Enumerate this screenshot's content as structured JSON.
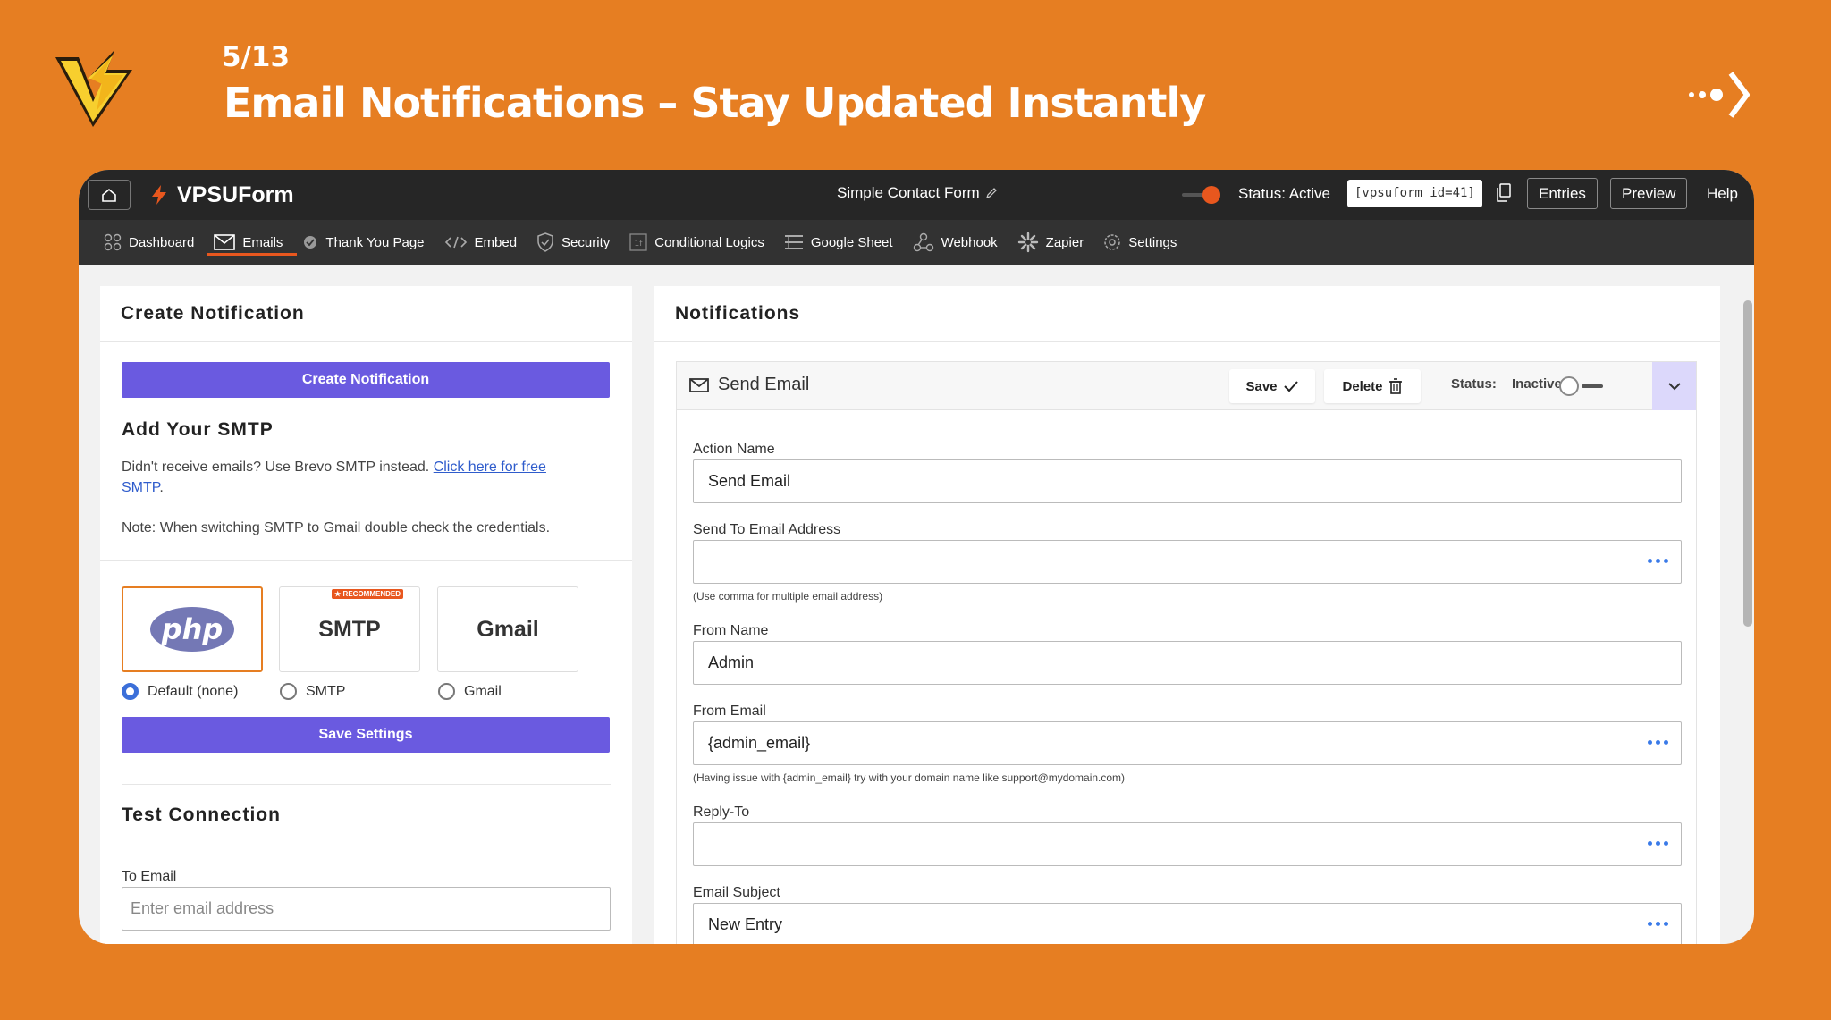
{
  "hero": {
    "counter": "5/13",
    "title": "Email Notifications – Stay Updated Instantly"
  },
  "colors": {
    "background": "#e67e22",
    "accent_purple": "#6a5ae0",
    "accent_orange": "#e8571e",
    "topbar": "#262626"
  },
  "topbar": {
    "brand": "VPSUForm",
    "form_name": "Simple Contact Form",
    "status": "Status: Active",
    "shortcode": "[vpsuform id=41]",
    "entries": "Entries",
    "preview": "Preview",
    "help": "Help"
  },
  "nav": [
    {
      "label": "Dashboard",
      "icon": "dashboard-icon"
    },
    {
      "label": "Emails",
      "icon": "envelope-icon",
      "active": true
    },
    {
      "label": "Thank You Page",
      "icon": "check-circle-icon"
    },
    {
      "label": "Embed",
      "icon": "code-icon"
    },
    {
      "label": "Security",
      "icon": "shield-icon"
    },
    {
      "label": "Conditional Logics",
      "icon": "logic-icon"
    },
    {
      "label": "Google Sheet",
      "icon": "sheet-icon"
    },
    {
      "label": "Webhook",
      "icon": "webhook-icon"
    },
    {
      "label": "Zapier",
      "icon": "zapier-icon"
    },
    {
      "label": "Settings",
      "icon": "gear-icon"
    }
  ],
  "left": {
    "title": "Create Notification",
    "create_btn": "Create Notification",
    "smtp_title": "Add Your SMTP",
    "smtp_text": "Didn't receive emails? Use Brevo SMTP instead.",
    "smtp_link_1": "Click here for free",
    "smtp_link_2": "SMTP",
    "smtp_period": ".",
    "note": "Note: When switching SMTP to Gmail double check the credentials.",
    "cards": {
      "php": "php",
      "smtp": "SMTP",
      "gmail": "Gmail",
      "recommended": "★ RECOMMENDED"
    },
    "radios": [
      "Default (none)",
      "SMTP",
      "Gmail"
    ],
    "save_btn": "Save Settings",
    "test_title": "Test Connection",
    "to_email_label": "To Email",
    "to_email_placeholder": "Enter email address"
  },
  "right": {
    "title": "Notifications",
    "action_title": "Send Email",
    "save": "Save",
    "delete": "Delete",
    "status_label": "Status:",
    "status_value": "Inactive",
    "fields": {
      "action_name_label": "Action Name",
      "action_name_value": "Send Email",
      "send_to_label": "Send To Email Address",
      "send_to_help": "(Use comma for multiple email address)",
      "from_name_label": "From Name",
      "from_name_value": "Admin",
      "from_email_label": "From Email",
      "from_email_value": "{admin_email}",
      "from_email_help": "(Having issue with {admin_email} try with your domain name like support@mydomain.com)",
      "reply_to_label": "Reply-To",
      "subject_label": "Email Subject",
      "subject_value": "New Entry"
    }
  }
}
